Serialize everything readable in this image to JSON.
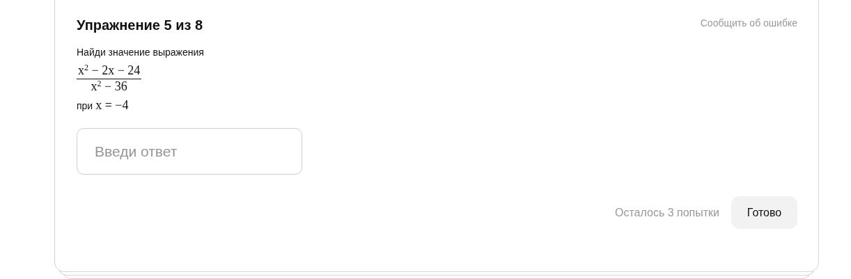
{
  "card": {
    "title": "Упражнение 5 из 8",
    "report_link": "Сообщить об ошибке",
    "instruction": "Найди значение выражения",
    "expression": {
      "numerator": "x$^{2}$ − 2x − 24",
      "denominator": "x$^{2}$ − 36"
    },
    "condition": {
      "prefix": "при",
      "formula": "x = −4"
    },
    "answer_field": {
      "placeholder": "Введи ответ"
    },
    "attempts": "Осталось 3 попытки",
    "submit_button": "Готово"
  }
}
